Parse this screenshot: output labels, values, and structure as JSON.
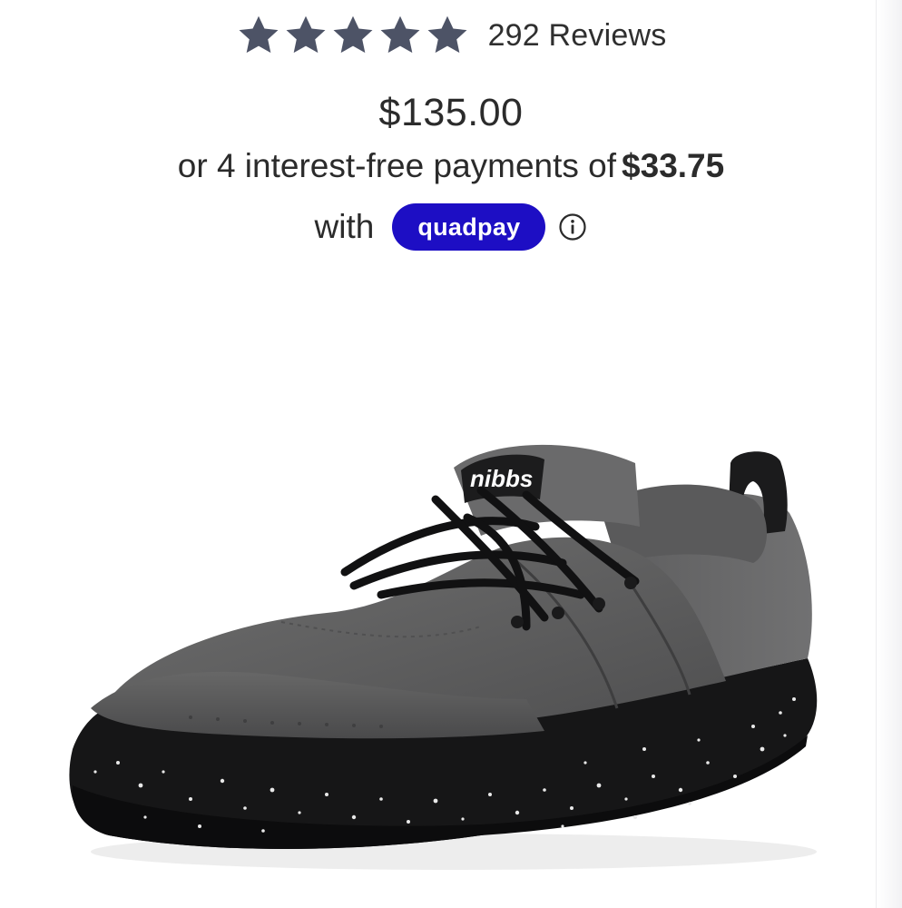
{
  "rating": {
    "stars_filled": 5,
    "stars_total": 5,
    "star_color": "#4d5366",
    "reviews_text": "292 Reviews"
  },
  "price": {
    "amount": "$135.00"
  },
  "installments": {
    "text": "or 4 interest-free payments of",
    "amount": "$33.75",
    "with_text": "with",
    "provider_label": "quadpay",
    "provider_color": "#1d0ec4",
    "info_icon": "info-circle-icon"
  },
  "product": {
    "image_icon": "sneaker-image",
    "brand_mark": "nibbs"
  }
}
